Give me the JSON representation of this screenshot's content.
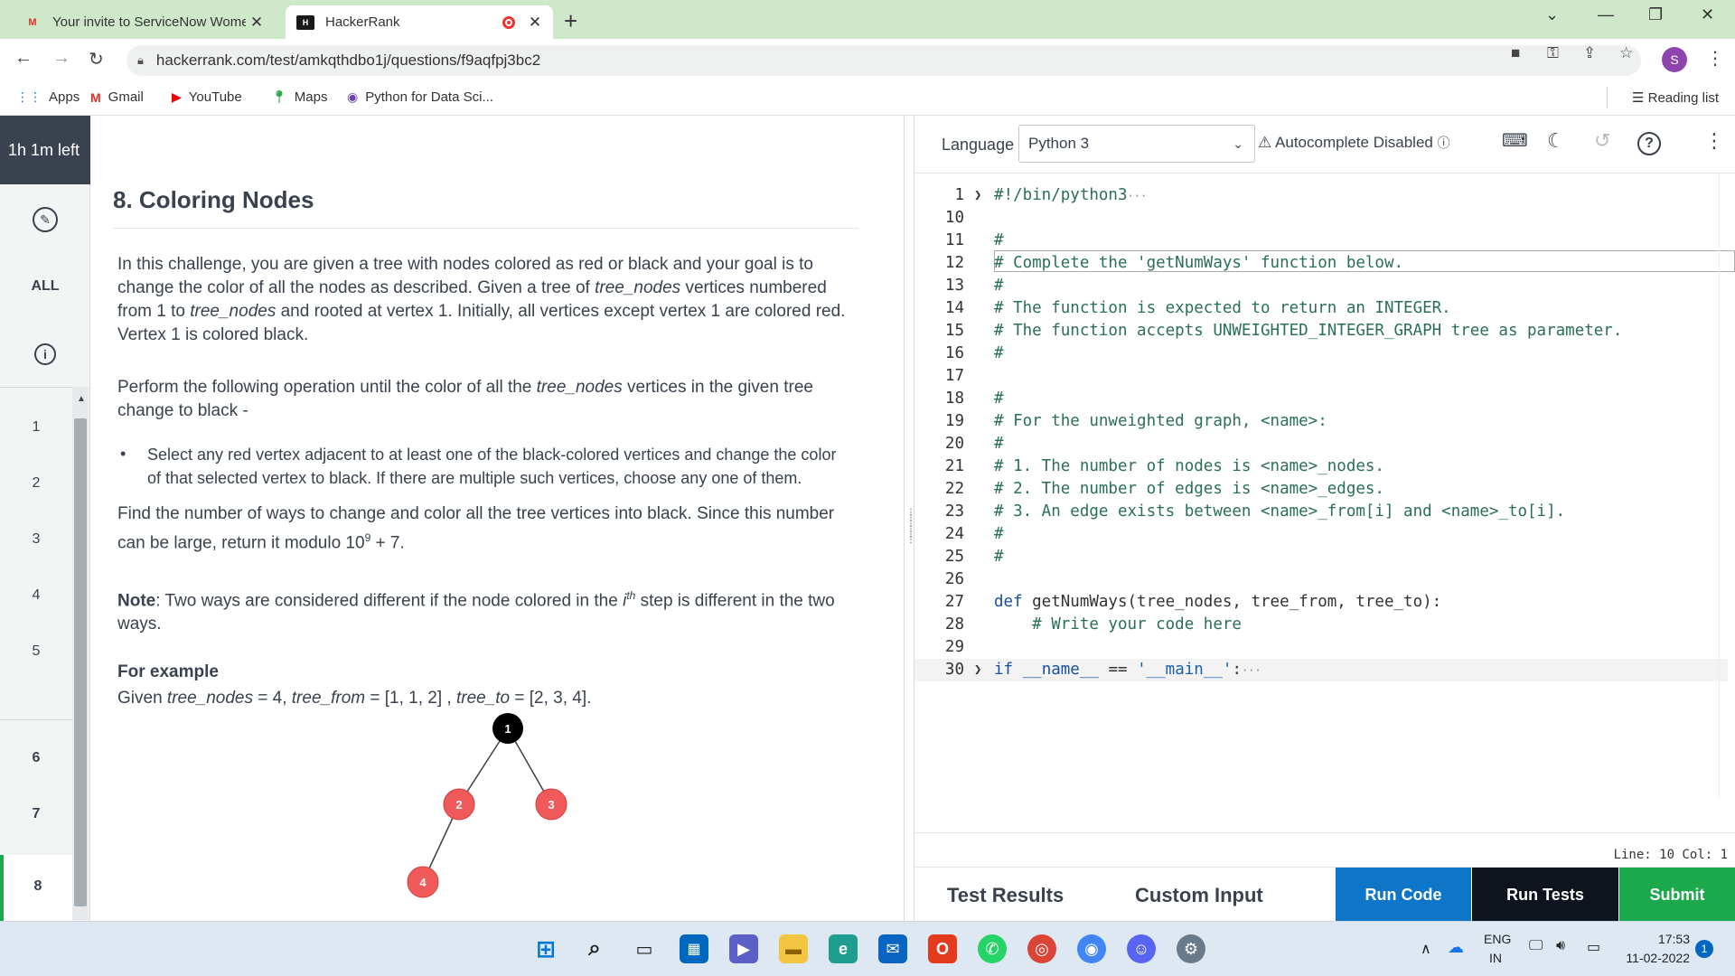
{
  "browser": {
    "tabs": [
      {
        "title": "Your invite to ServiceNow Wome",
        "icon": "gmail-icon"
      },
      {
        "title": "HackerRank",
        "icon": "hackerrank-icon"
      }
    ],
    "url": "hackerrank.com/test/amkqthdbo1j/questions/f9aqfpj3bc2",
    "profile_initial": "S",
    "bookmarks": [
      "Apps",
      "Gmail",
      "YouTube",
      "Maps",
      "Python for Data Sci..."
    ],
    "reading_list": "Reading list"
  },
  "rail": {
    "timer": "1h 1m left",
    "all_label": "ALL",
    "questions": [
      "1",
      "2",
      "3",
      "4",
      "5",
      "6",
      "7",
      "8"
    ],
    "active_question": "8"
  },
  "problem": {
    "title": "8. Coloring Nodes",
    "p1_a": "In this challenge, you are given a tree with nodes colored as red or black and your goal is to change the color of all the nodes as described. Given a tree of ",
    "p1_var1": "tree_nodes",
    "p1_b": " vertices numbered from 1 to ",
    "p1_var2": "tree_nodes",
    "p1_c": " and rooted at vertex 1. Initially, all vertices except vertex 1 are colored red. Vertex 1 is colored black.",
    "p2_a": "Perform the following operation until the color of all the ",
    "p2_var": "tree_nodes",
    "p2_b": " vertices in the given tree change to black -",
    "bullet": "Select any red vertex adjacent to at least one of the black-colored vertices and change the color of that selected vertex to black. If there are multiple such vertices, choose any one of them.",
    "p3": "Find the number of ways to change and color all the tree vertices into black. Since this number can be large, return it modulo 10",
    "p3_sup": "9",
    "p3_tail": " + 7.",
    "note_label": "Note",
    "note_a": ": Two ways are considered different if the node colored in the ",
    "note_var": "i",
    "note_sup": "th",
    "note_b": " step is different in the two ways.",
    "example_heading": "For example",
    "example_a": "Given ",
    "example_v1": "tree_nodes",
    "example_b": " = 4, ",
    "example_v2": "tree_from",
    "example_c": " = [1, 1, 2] , ",
    "example_v3": "tree_to",
    "example_d": " = [2, 3, 4].",
    "tree_nodes": [
      {
        "label": "1",
        "color": "#000000"
      },
      {
        "label": "2",
        "color": "#f05a5a"
      },
      {
        "label": "3",
        "color": "#f05a5a"
      },
      {
        "label": "4",
        "color": "#f05a5a"
      }
    ]
  },
  "editor": {
    "language_label": "Language",
    "language": "Python 3",
    "autocomplete": "Autocomplete Disabled",
    "lines": [
      {
        "n": "1",
        "text": "#!/bin/python3",
        "cls": "cmt",
        "fold": true,
        "ellipsis": true
      },
      {
        "n": "10",
        "text": "",
        "cls": ""
      },
      {
        "n": "11",
        "text": "#",
        "cls": "cmt"
      },
      {
        "n": "12",
        "text": "# Complete the 'getNumWays' function below.",
        "cls": "cmt"
      },
      {
        "n": "13",
        "text": "#",
        "cls": "cmt"
      },
      {
        "n": "14",
        "text": "# The function is expected to return an INTEGER.",
        "cls": "cmt"
      },
      {
        "n": "15",
        "text": "# The function accepts UNWEIGHTED_INTEGER_GRAPH tree as parameter.",
        "cls": "cmt"
      },
      {
        "n": "16",
        "text": "#",
        "cls": "cmt"
      },
      {
        "n": "17",
        "text": "",
        "cls": ""
      },
      {
        "n": "18",
        "text": "#",
        "cls": "cmt"
      },
      {
        "n": "19",
        "text": "# For the unweighted graph, <name>:",
        "cls": "cmt"
      },
      {
        "n": "20",
        "text": "#",
        "cls": "cmt"
      },
      {
        "n": "21",
        "text": "# 1. The number of nodes is <name>_nodes.",
        "cls": "cmt"
      },
      {
        "n": "22",
        "text": "# 2. The number of edges is <name>_edges.",
        "cls": "cmt"
      },
      {
        "n": "23",
        "text": "# 3. An edge exists between <name>_from[i] and <name>_to[i].",
        "cls": "cmt"
      },
      {
        "n": "24",
        "text": "#",
        "cls": "cmt"
      },
      {
        "n": "25",
        "text": "#",
        "cls": "cmt"
      },
      {
        "n": "26",
        "text": "",
        "cls": ""
      },
      {
        "n": "27",
        "text": "def getNumWays(tree_nodes, tree_from, tree_to):",
        "cls": "def"
      },
      {
        "n": "28",
        "text": "    # Write your code here",
        "cls": "cmt"
      },
      {
        "n": "29",
        "text": "",
        "cls": ""
      },
      {
        "n": "30",
        "text": "if __name__ == '__main__':",
        "cls": "main",
        "fold": true,
        "ellipsis": true
      }
    ],
    "status": "Line: 10 Col: 1",
    "bottom_tabs": [
      "Test Results",
      "Custom Input"
    ],
    "buttons": {
      "run_code": "Run Code",
      "run_tests": "Run Tests",
      "submit": "Submit"
    }
  },
  "taskbar": {
    "lang_line1": "ENG",
    "lang_line2": "IN",
    "time": "17:53",
    "date": "11-02-2022",
    "notification_count": "1"
  }
}
